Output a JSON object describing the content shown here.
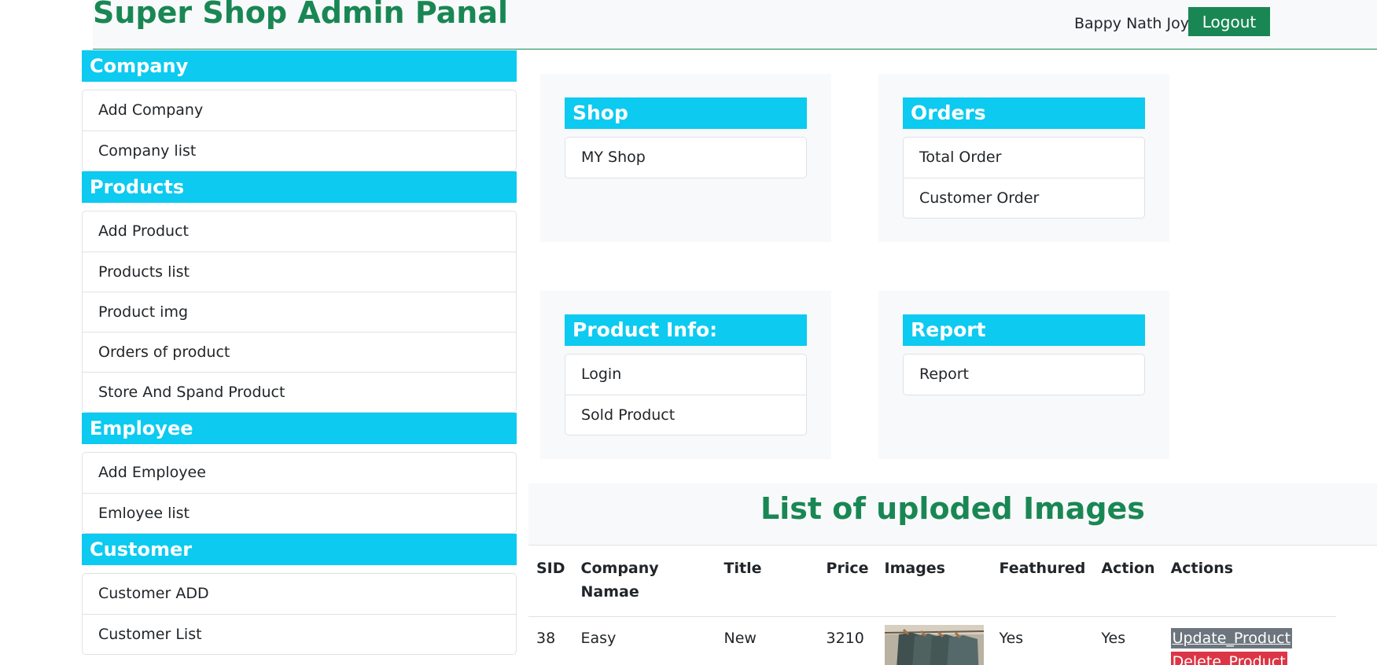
{
  "header": {
    "title": "Super Shop Admin Panal",
    "username": "Bappy Nath Joy",
    "logout_label": "Logout"
  },
  "sidebar": {
    "sections": [
      {
        "title": "Company",
        "items": [
          "Add Company",
          "Company list"
        ]
      },
      {
        "title": "Products",
        "items": [
          "Add Product",
          "Products list",
          "Product img",
          "Orders of product",
          "Store And Spand Product"
        ]
      },
      {
        "title": "Employee",
        "items": [
          "Add Employee",
          "Emloyee list"
        ]
      },
      {
        "title": "Customer",
        "items": [
          "Customer ADD",
          "Customer List"
        ]
      }
    ]
  },
  "cards": {
    "shop": {
      "title": "Shop",
      "items": [
        "MY Shop"
      ]
    },
    "orders": {
      "title": "Orders",
      "items": [
        "Total Order",
        "Customer Order"
      ]
    },
    "product_info": {
      "title": "Product Info:",
      "items": [
        "Login",
        "Sold Product"
      ]
    },
    "report": {
      "title": "Report",
      "items": [
        "Report"
      ]
    }
  },
  "images_table": {
    "title": "List of uploded Images",
    "columns": [
      "SID",
      "Company Namae",
      "Title",
      "Price",
      "Images",
      "Feathured",
      "Action",
      "Actions"
    ],
    "rows": [
      {
        "sid": "38",
        "company": "Easy",
        "title": "New",
        "price": "3210",
        "image_icon": "clothing-rack-photo",
        "featured": "Yes",
        "action": "Yes",
        "update_label": "Update_Product",
        "delete_label": "Delete_Product"
      }
    ]
  },
  "colors": {
    "brand_green": "#198754",
    "section_cyan": "#0dcaf0",
    "panel_gray": "#f8f9fa",
    "update_gray": "#6c757d",
    "delete_red": "#dc3545"
  }
}
